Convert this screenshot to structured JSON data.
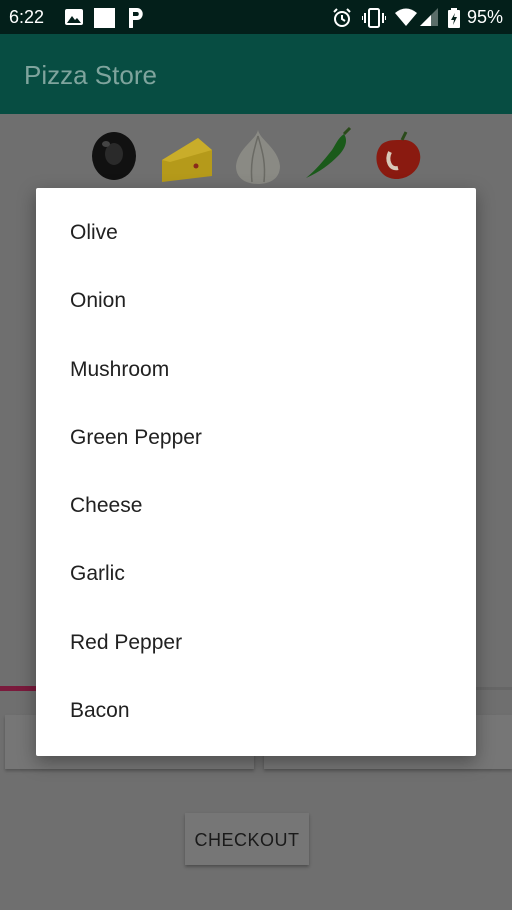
{
  "status_bar": {
    "time": "6:22",
    "battery": "95%",
    "left_icons": [
      "image-icon",
      "square-icon",
      "parking-p-icon"
    ],
    "right_icons": [
      "alarm-icon",
      "vibrate-icon",
      "wifi-icon",
      "signal-icon",
      "battery-charging-icon"
    ]
  },
  "app_bar": {
    "title": "Pizza Store",
    "color": "#074d42"
  },
  "toppings_bar": {
    "icons": [
      "olive-icon",
      "cheese-icon",
      "garlic-icon",
      "chili-pepper-icon",
      "red-pepper-icon"
    ]
  },
  "dialog": {
    "items": [
      "Olive",
      "Onion",
      "Mushroom",
      "Green Pepper",
      "Cheese",
      "Garlic",
      "Red Pepper",
      "Bacon"
    ]
  },
  "checkout": {
    "label": "CHECKOUT"
  },
  "colors": {
    "accent": "#7a1a3c",
    "scrim": "#6f6f6f"
  }
}
